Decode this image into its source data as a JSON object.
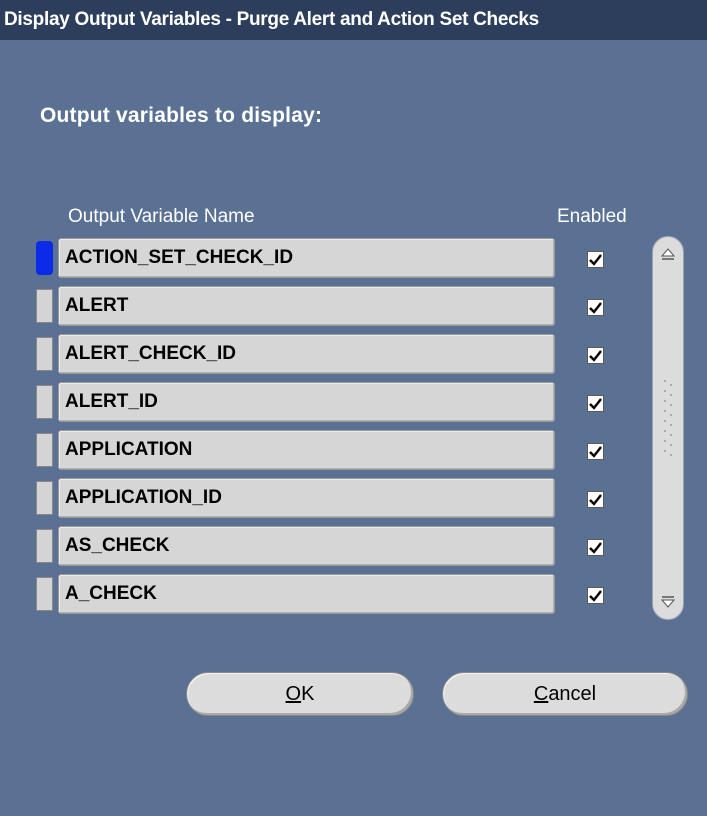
{
  "window": {
    "title": "Display Output Variables - Purge Alert and Action Set Checks"
  },
  "section_label": "Output variables to display:",
  "table": {
    "headers": {
      "name": "Output Variable Name",
      "enabled": "Enabled"
    },
    "rows": [
      {
        "name": "ACTION_SET_CHECK_ID",
        "enabled": true,
        "current": true
      },
      {
        "name": "ALERT",
        "enabled": true
      },
      {
        "name": "ALERT_CHECK_ID",
        "enabled": true
      },
      {
        "name": "ALERT_ID",
        "enabled": true
      },
      {
        "name": "APPLICATION",
        "enabled": true
      },
      {
        "name": "APPLICATION_ID",
        "enabled": true
      },
      {
        "name": "AS_CHECK",
        "enabled": true
      },
      {
        "name": "A_CHECK",
        "enabled": true
      }
    ]
  },
  "buttons": {
    "ok": {
      "mnemonic": "O",
      "rest": "K"
    },
    "cancel": {
      "mnemonic": "C",
      "rest": "ancel"
    }
  },
  "colors": {
    "background": "#5a7194",
    "titlebar": "#2c3e5c",
    "current_row_indicator": "#0b2be8"
  },
  "icons": {
    "scroll_up": "scroll-up-arrow-icon",
    "scroll_down": "scroll-down-arrow-icon",
    "checkbox": "checkmark-icon"
  }
}
